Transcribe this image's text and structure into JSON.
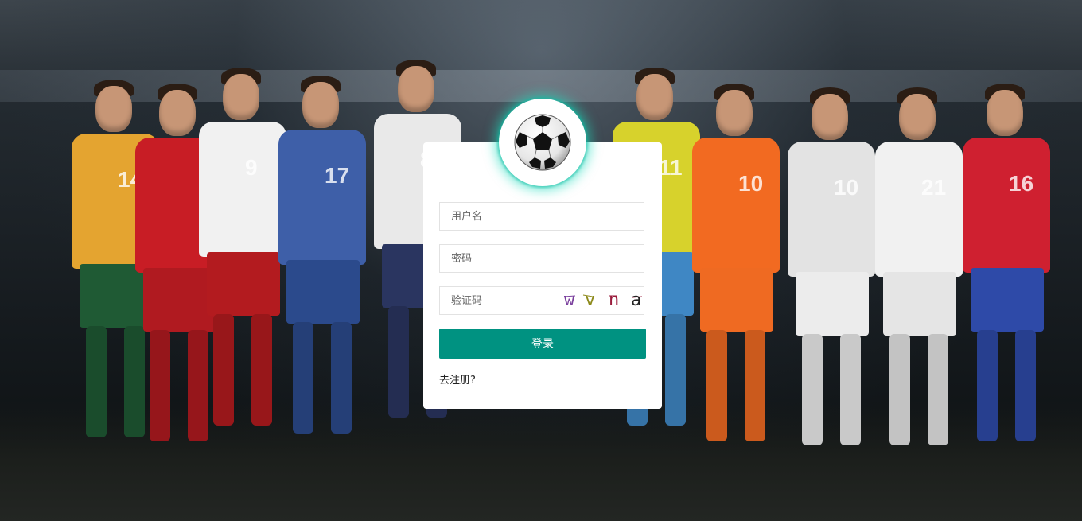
{
  "login": {
    "username_placeholder": "用户名",
    "password_placeholder": "密码",
    "captcha_placeholder": "验证码",
    "captcha_chars": [
      "w",
      "v",
      "n",
      "a"
    ],
    "login_button": "登录",
    "register_link": "去注册?"
  },
  "background": {
    "players": [
      {
        "shirt": "#e4a430",
        "shorts": "#1f5a34",
        "number": "14"
      },
      {
        "shirt": "#c81d25",
        "shorts": "#b01a20",
        "number": ""
      },
      {
        "shirt": "#f1f1f1",
        "shorts": "#b31b1f",
        "number": "9"
      },
      {
        "shirt": "#3e5fa8",
        "shorts": "#2b4a8c",
        "number": "17"
      },
      {
        "shirt": "#e9e9e9",
        "shorts": "#2a3560",
        "number": "8"
      },
      {
        "shirt": "#d7d22c",
        "shorts": "#3f87c4",
        "number": "11"
      },
      {
        "shirt": "#f26a21",
        "shorts": "#ef6a22",
        "number": "10"
      },
      {
        "shirt": "#e3e3e3",
        "shorts": "#ececec",
        "number": "10"
      },
      {
        "shirt": "#f1f1f1",
        "shorts": "#e5e5e5",
        "number": "21"
      },
      {
        "shirt": "#cf2030",
        "shorts": "#2e4aa8",
        "number": "16"
      }
    ]
  },
  "colors": {
    "primary": "#009281",
    "logo_glow": "#1edcbe",
    "captcha_colors": [
      "#7a3f9d",
      "#8d8a1c",
      "#9a1b3c",
      "#222222"
    ]
  },
  "icons": {
    "logo": "soccer-ball-icon"
  }
}
